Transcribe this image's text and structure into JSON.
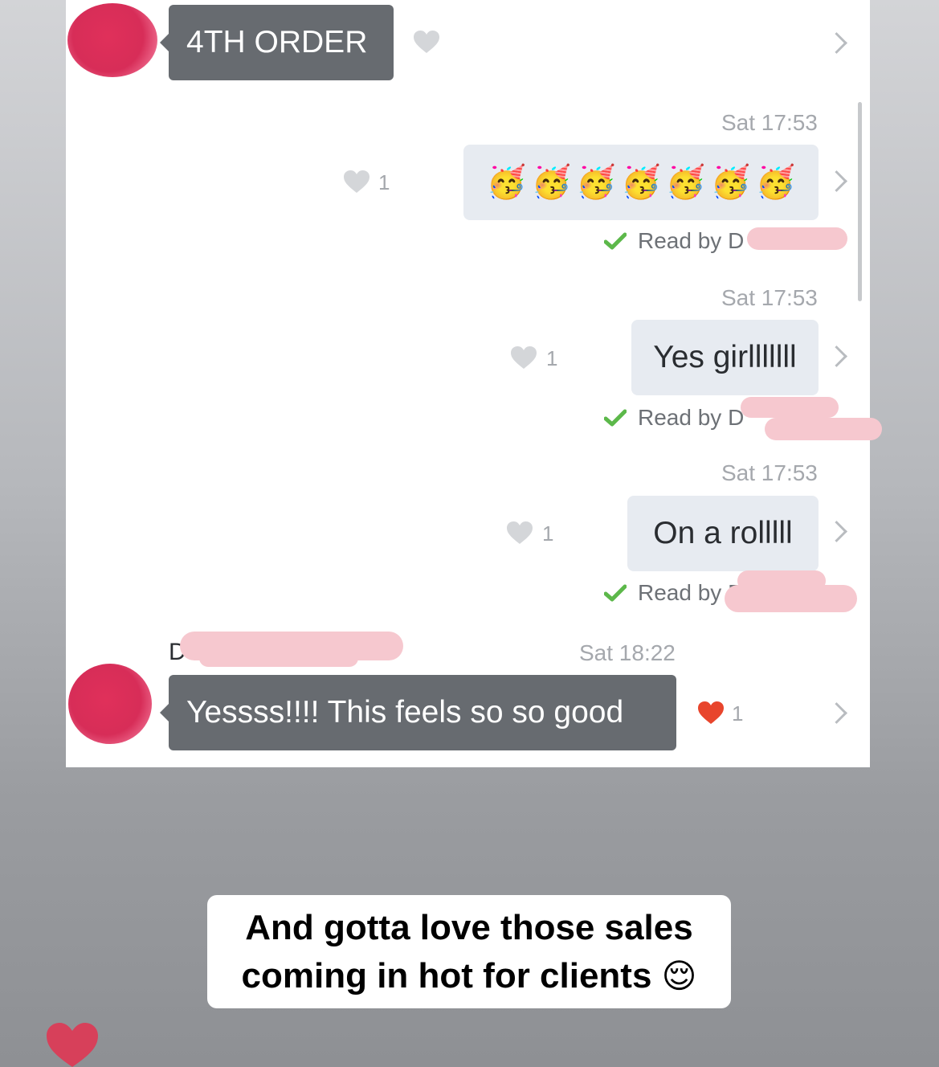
{
  "messages": [
    {
      "type": "incoming",
      "text": "4TH ORDER"
    },
    {
      "type": "outgoing",
      "timestamp": "Sat 17:53",
      "emoji": [
        "🥳",
        "🥳",
        "🥳",
        "🥳",
        "🥳",
        "🥳",
        "🥳"
      ],
      "likes": "1",
      "read_label": "Read by D"
    },
    {
      "type": "outgoing",
      "timestamp": "Sat 17:53",
      "text": "Yes girlllllll",
      "likes": "1",
      "read_label": "Read by D"
    },
    {
      "type": "outgoing",
      "timestamp": "Sat 17:53",
      "text": "On a rolllll",
      "likes": "1",
      "read_label": "Read by D"
    },
    {
      "type": "incoming",
      "sender": "D",
      "timestamp": "Sat 18:22",
      "text": "Yessss!!!! This feels so so good",
      "likes": "1"
    }
  ],
  "caption": {
    "line1": "And gotta love those sales",
    "line2": "coming in hot for clients",
    "emoji": "😌"
  },
  "colors": {
    "incoming_bubble": "#676b70",
    "outgoing_bubble": "#e7ebf1",
    "like_heart": "#e8452c",
    "story_heart": "#d7405a",
    "read_check": "#5cb84a"
  }
}
